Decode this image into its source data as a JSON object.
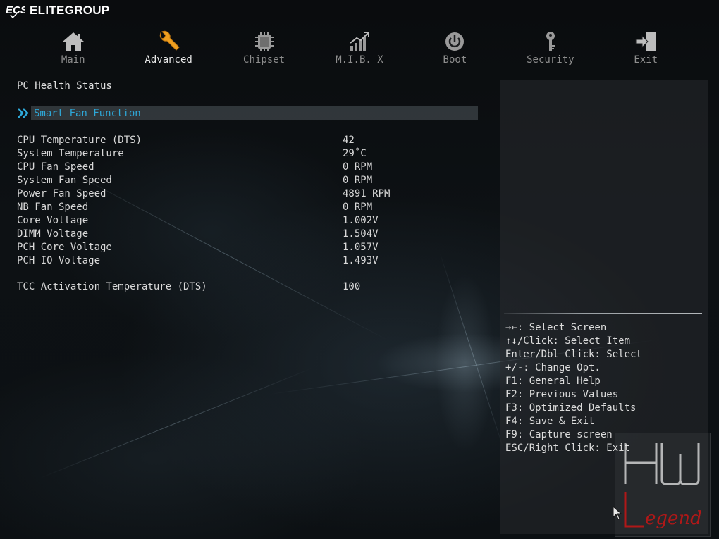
{
  "brand": {
    "logo": "ECS",
    "name": "ELITEGROUP"
  },
  "tabs": [
    {
      "label": "Main",
      "icon": "home-icon"
    },
    {
      "label": "Advanced",
      "icon": "wrench-icon",
      "active": true
    },
    {
      "label": "Chipset",
      "icon": "chip-icon"
    },
    {
      "label": "M.I.B. X",
      "icon": "chart-icon"
    },
    {
      "label": "Boot",
      "icon": "power-icon"
    },
    {
      "label": "Security",
      "icon": "key-icon"
    },
    {
      "label": "Exit",
      "icon": "exit-icon"
    }
  ],
  "main": {
    "title": "PC Health Status",
    "submenu_label": "Smart Fan Function",
    "rows": [
      {
        "label": "CPU Temperature (DTS)",
        "value": "42"
      },
      {
        "label": "System Temperature",
        "value": "29˚C"
      },
      {
        "label": "CPU Fan Speed",
        "value": "0 RPM"
      },
      {
        "label": "System Fan Speed",
        "value": "0 RPM"
      },
      {
        "label": "Power Fan Speed",
        "value": "4891 RPM"
      },
      {
        "label": "NB Fan Speed",
        "value": "0 RPM"
      },
      {
        "label": "Core Voltage",
        "value": "1.002V"
      },
      {
        "label": "DIMM Voltage",
        "value": "1.504V"
      },
      {
        "label": "PCH Core Voltage",
        "value": "1.057V"
      },
      {
        "label": "PCH IO Voltage",
        "value": "1.493V"
      }
    ],
    "tcc": {
      "label": "TCC Activation Temperature (DTS)",
      "value": "100"
    }
  },
  "help": [
    "→←: Select Screen",
    "↑↓/Click: Select Item",
    "Enter/Dbl Click: Select",
    "+/-: Change Opt.",
    "F1: General Help",
    "F2: Previous Values",
    "F3: Optimized Defaults",
    "F4: Save & Exit",
    "F9: Capture screen",
    "ESC/Right Click: Exit"
  ],
  "watermark": {
    "top": "HW",
    "bottom": "Legend"
  },
  "colors": {
    "accent": "#2ea8d8",
    "highlight_bar": "#50585c",
    "text": "#d8d8d8",
    "watermark_red": "#b01818"
  }
}
